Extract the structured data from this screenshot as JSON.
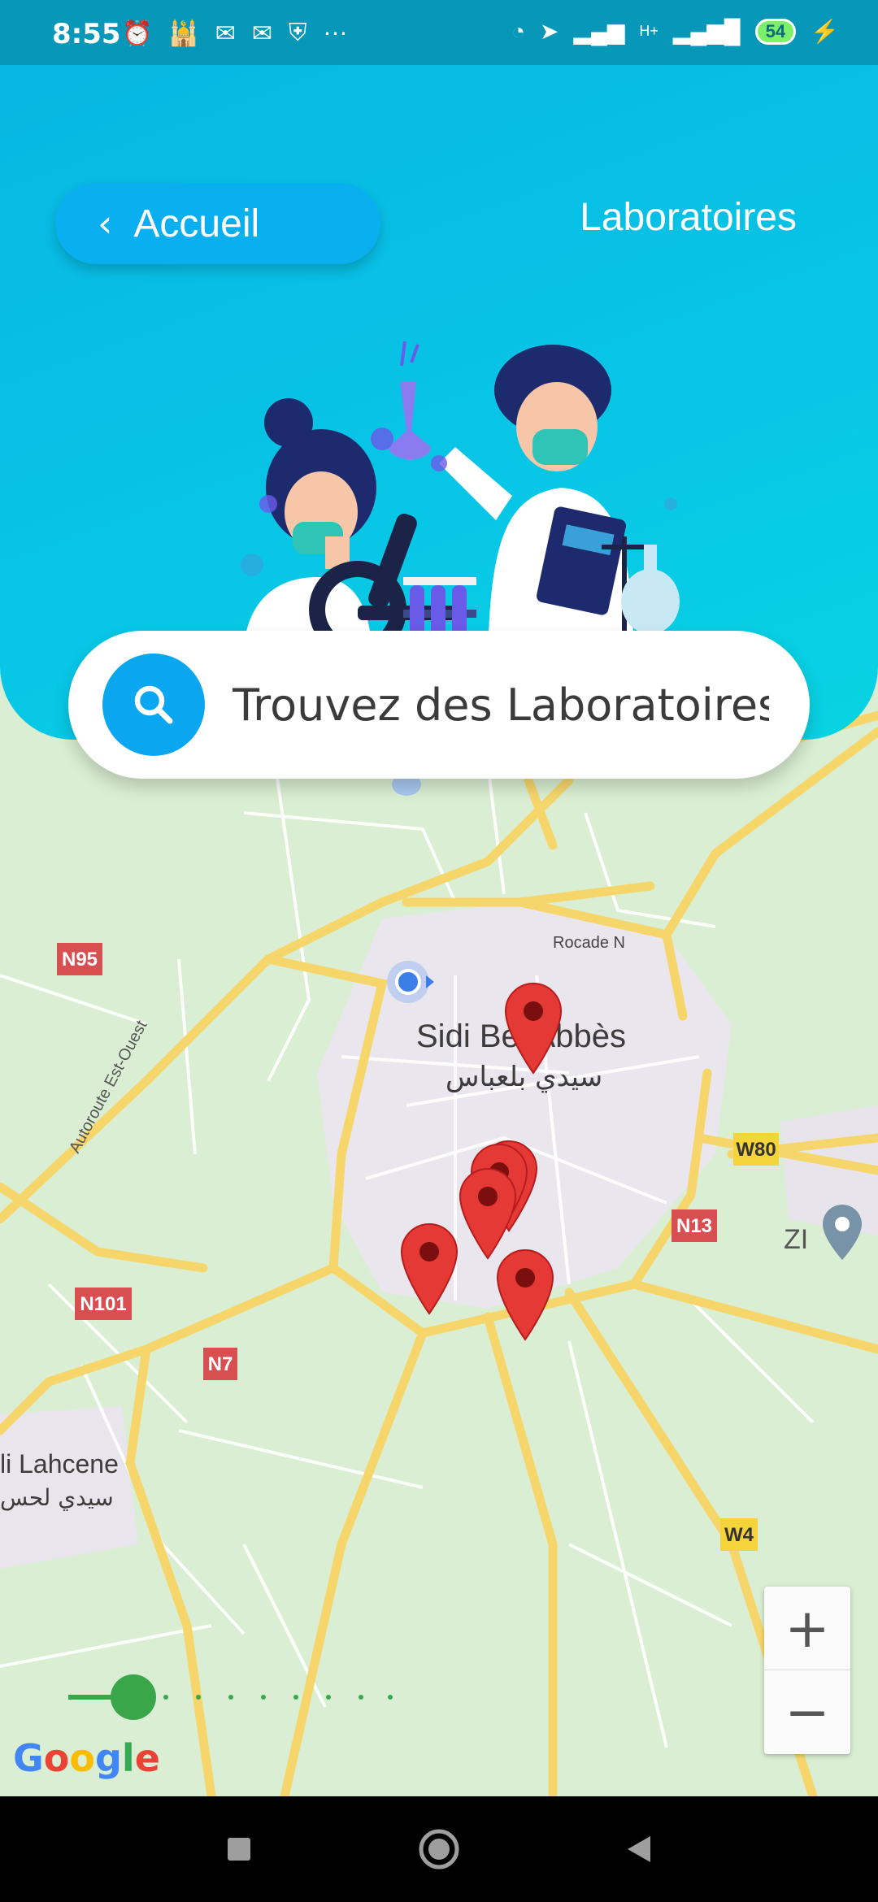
{
  "status_bar": {
    "time": "8:55",
    "battery": "54",
    "network": "H+"
  },
  "header": {
    "back_label": "Accueil",
    "title": "Laboratoires"
  },
  "search": {
    "placeholder": "Trouvez des Laboratoires"
  },
  "map": {
    "labels": {
      "city": "Sidi Bel Abbès",
      "city_ar": "سيدي بلعباس",
      "rocade": "Rocade N",
      "autoroute": "Autoroute Est-Ouest",
      "zi": "ZI",
      "lahcene": "li Lahcene",
      "lahcene_ar": "سيدي لحس"
    },
    "road_shields": {
      "n95": "N95",
      "w80": "W80",
      "n13": "N13",
      "n101": "N101",
      "n7": "N7",
      "w4": "W4"
    },
    "lab_markers": 6,
    "zoom_in": "+",
    "zoom_out": "−",
    "attribution": "Google"
  },
  "colors": {
    "header": "#08b6e3",
    "accent": "#0aa7f0",
    "marker": "#e53935",
    "road": "#f6d66b",
    "shield_red": "#d84f52",
    "shield_yellow": "#f5d33a"
  }
}
